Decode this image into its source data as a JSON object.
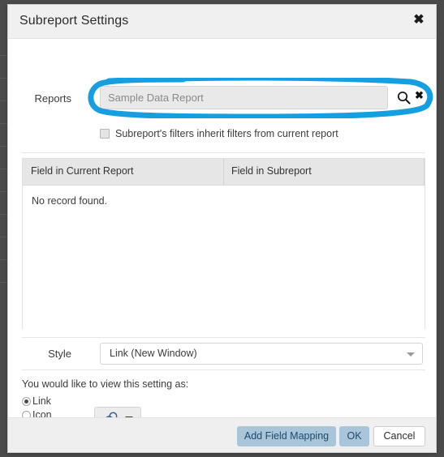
{
  "dialog": {
    "title": "Subreport Settings",
    "close_icon": "close-icon",
    "close_glyph": "✖"
  },
  "reports": {
    "label": "Reports",
    "search_value": "",
    "search_placeholder": "Sample Data Report",
    "search_icon": "search-icon",
    "clear_icon": "clear-icon",
    "clear_glyph": "✖"
  },
  "inherit": {
    "label": "Subreport's filters inherit filters from current report",
    "checked": false
  },
  "mapping_table": {
    "columns": [
      "Field in Current Report",
      "Field in Subreport",
      ""
    ],
    "rows": [],
    "empty_message": "No record found."
  },
  "style": {
    "label": "Style",
    "selected": "Link (New Window)",
    "caret_icon": "chevron-down-icon"
  },
  "view_as": {
    "prompt": "You would like to view this setting as:",
    "options": [
      {
        "label": "Link",
        "selected": true
      },
      {
        "label": "Icon",
        "selected": false
      }
    ],
    "icon_picker": {
      "glyph_icon": "link-chain-icon",
      "caret_icon": "chevron-down-icon"
    }
  },
  "footer": {
    "add_field_mapping": "Add Field Mapping",
    "ok": "OK",
    "cancel": "Cancel"
  },
  "annotation": {
    "shape": "ellipse-highlight",
    "color": "#159fe0"
  },
  "colors": {
    "accent_annotation": "#159fe0",
    "primary_button_bg": "#a8c5da",
    "primary_button_text": "#1f4a6b",
    "titlebar_bg": "#f0f0f0",
    "footer_bg": "#efefef",
    "table_header_bg": "#e6e6e6",
    "search_field_bg": "#e9e9e9",
    "page_backdrop": "#4a4a4a"
  }
}
